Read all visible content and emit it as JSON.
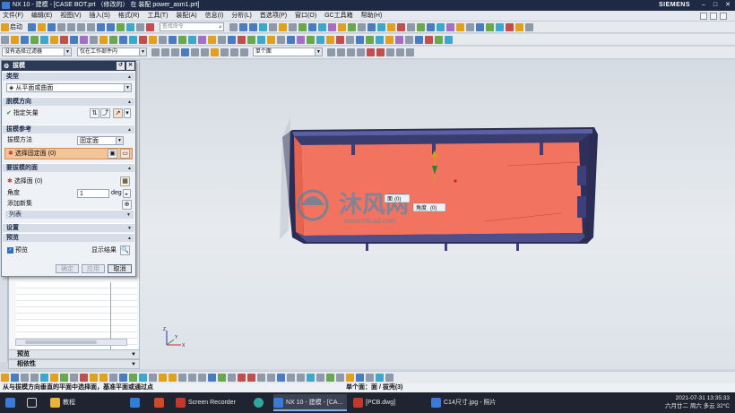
{
  "window": {
    "title": "NX 10 - 建模 - [CASE BOT.prt （修改的） 在 装配 power_asm1.prt]",
    "brand": "SIEMENS",
    "minimize": "–",
    "maximize": "□",
    "close": "✕"
  },
  "menu": [
    "文件(F)",
    "编辑(E)",
    "视图(V)",
    "插入(S)",
    "格式(R)",
    "工具(T)",
    "装配(A)",
    "信息(I)",
    "分析(L)",
    "首选项(P)",
    "窗口(O)",
    "GC工具箱",
    "帮助(H)"
  ],
  "toolbar": {
    "start_label": "启动",
    "search_placeholder": "查找命令",
    "filter_none": "没有选择过滤器",
    "filter_scope": "仅在工作部件内",
    "filter_single": "单个面"
  },
  "dialog": {
    "title": "拔模",
    "sec_type": "类型",
    "type_value": "从平面或曲面",
    "sec_direction": "脱模方向",
    "specify_vector": "指定矢量",
    "sec_reference": "拔模参考",
    "draft_method_label": "拔模方法",
    "draft_method_value": "固定面",
    "select_fixed_face": "选择固定面 (0)",
    "sec_faces": "要拔模的面",
    "select_face": "选择面 (0)",
    "angle_label": "角度",
    "angle_value": "1",
    "angle_unit": "deg",
    "add_new_set": "添加新集",
    "list_label": "列表",
    "sec_settings": "设置",
    "sec_preview": "预览",
    "preview_checkbox": "预览",
    "show_result": "显示结果",
    "ok": "确定",
    "apply": "应用",
    "cancel": "取消"
  },
  "nav_panel": {
    "preview_header": "预览",
    "dependency_header": "相依性"
  },
  "viewport": {
    "watermark_big": "沐风网",
    "watermark_small": "www.mfcad.com",
    "tag_face": "面",
    "tag_face_value": "(0)",
    "tag_angle": "角度",
    "tag_angle_value": "(0)",
    "axis_z": "Z",
    "axis_x": "X",
    "axis_y": "Y"
  },
  "status": {
    "hint": "从与拔模方向垂直的平面中选择面，基准平面或通过点",
    "selection": "单个面：面 / 拔壳(3)"
  },
  "taskbar": {
    "items": [
      "教程",
      "Screen Recorder",
      "NX 10 - 建模 - [CA...",
      "[PCB.dwg]",
      "C14尺寸.jpg - 照片"
    ],
    "time": "2021-07-31 13:35:33",
    "date_line": "六月廿二 周六 多云 32°C"
  },
  "colors": {
    "face_highlight": "#f2735f",
    "body_edge": "#3e3f7a",
    "selection_orange": "#f2c49a",
    "title_bar": "#1e2a44"
  }
}
